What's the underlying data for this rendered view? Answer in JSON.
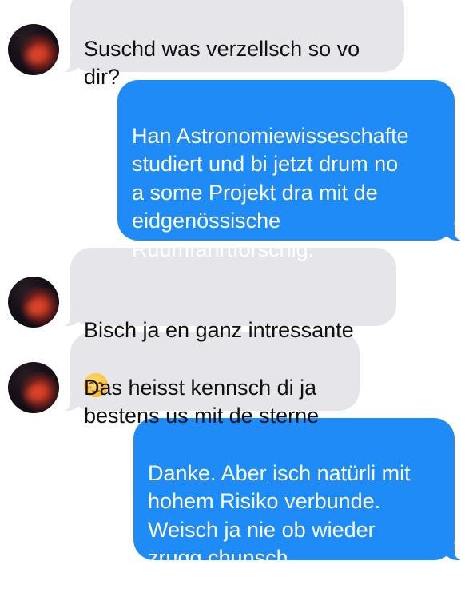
{
  "colors": {
    "incoming_bubble": "#e5e5ea",
    "outgoing_bubble": "#1e8bf6",
    "incoming_text": "#111111",
    "outgoing_text": "#ffffff"
  },
  "messages": [
    {
      "direction": "incoming",
      "text": "Suschd was verzellsch so vo\ndir?"
    },
    {
      "direction": "outgoing",
      "text": "Han Astronomiewisseschafte\nstudiert und bi jetzt drum no\na some Projekt dra mit de\neidgenössische\nRuumfahrtforschig."
    },
    {
      "direction": "incoming",
      "text": "Bisch ja en ganz intressante",
      "emoji": "smiling-face-with-blush-icon"
    },
    {
      "direction": "incoming",
      "text": "Das heisst kennsch di ja\nbestens us mit de sterne"
    },
    {
      "direction": "outgoing",
      "text": "Danke. Aber isch natürli mit\nhohem Risiko verbunde.\nWeisch ja nie ob wieder\nzrugg chunsch"
    }
  ]
}
